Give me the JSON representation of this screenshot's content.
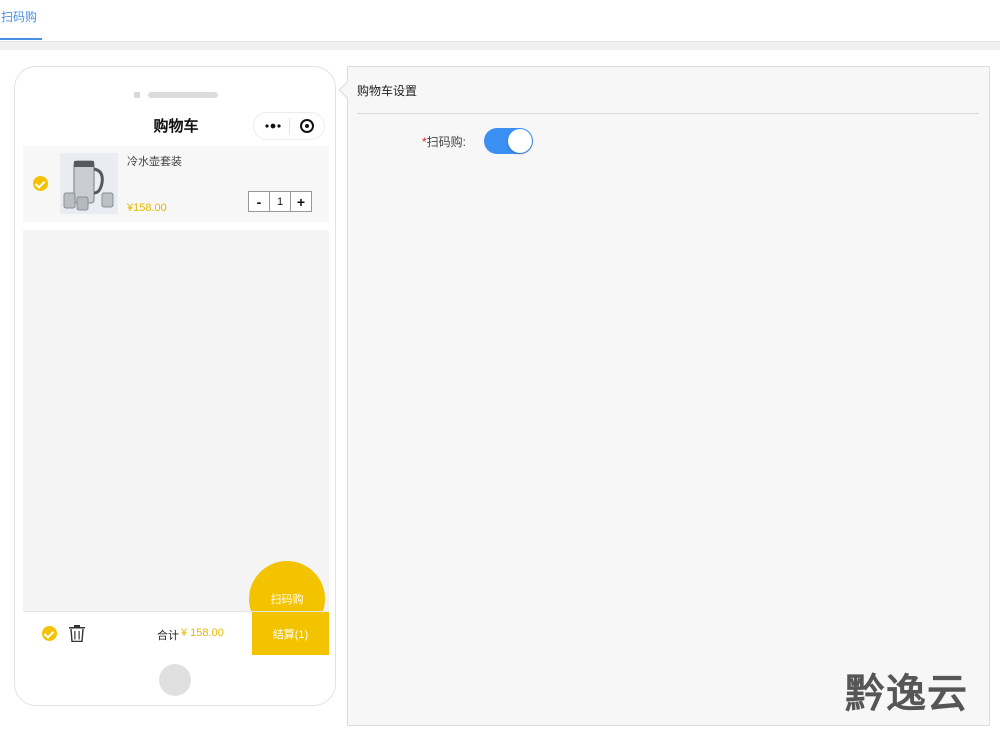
{
  "tabs": [
    {
      "label": "扫码购",
      "active": true
    }
  ],
  "phone": {
    "nav_title": "购物车",
    "cart_item": {
      "name": "冷水壶套装",
      "price": "¥158.00",
      "quantity": "1",
      "minus": "-",
      "plus": "+"
    },
    "fab_label": "扫码购",
    "total_label": "合计",
    "total_value": "¥ 158.00",
    "checkout_label": "结算(1)"
  },
  "settings": {
    "title": "购物车设置",
    "field_label": "扫码购:",
    "required_mark": "*",
    "toggle_on": true
  },
  "watermark": "黔逸云",
  "colors": {
    "accent": "#4a90e2",
    "yellow": "#f3c300",
    "switch": "#3b8ff3",
    "price": "#e3b800"
  }
}
